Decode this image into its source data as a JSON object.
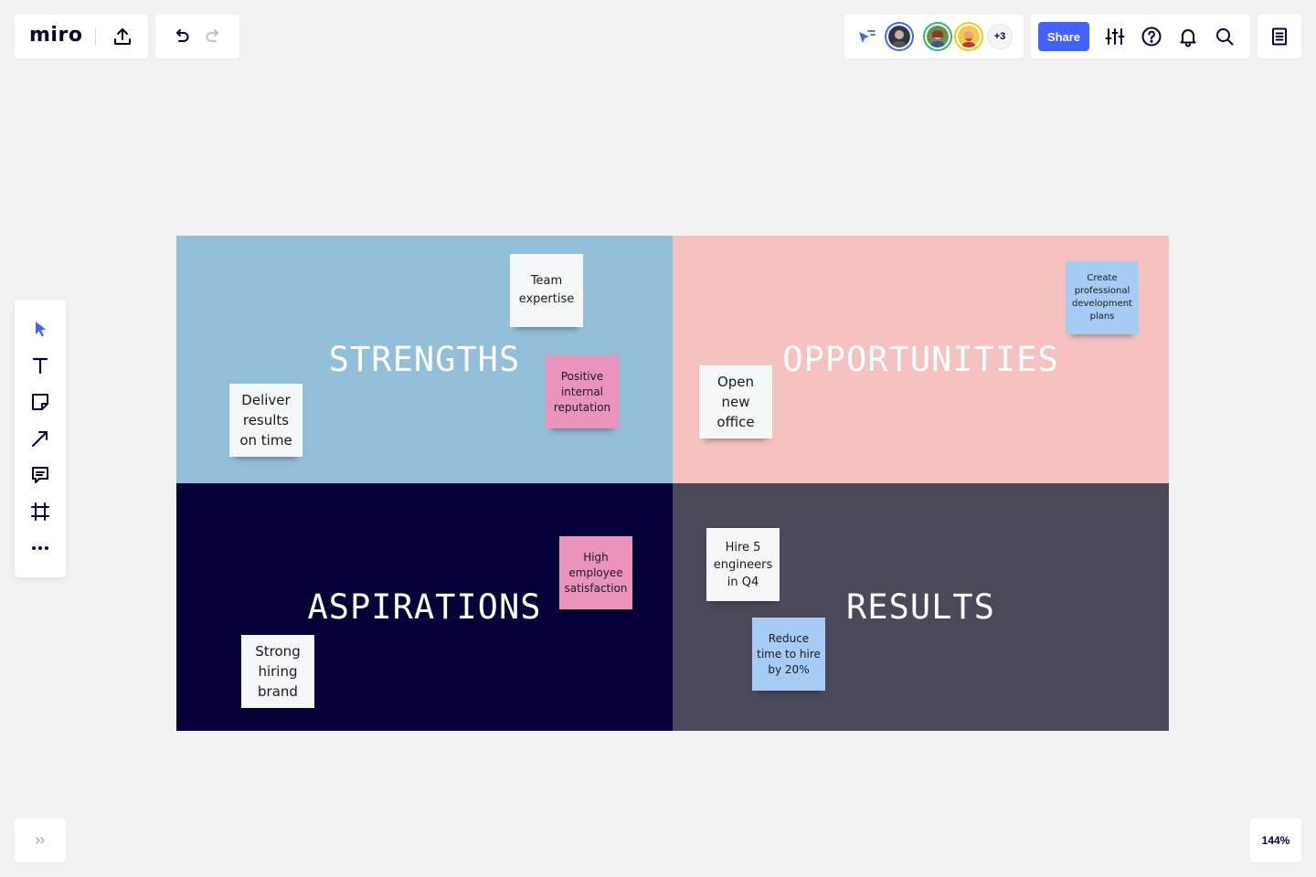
{
  "app": {
    "logo": "miro",
    "zoom_level": "144%"
  },
  "header": {
    "upload_icon": "upload-icon",
    "undo_icon": "undo-icon",
    "redo_icon": "redo-icon",
    "collaborators": {
      "attention_icon": "cursor-follow-icon",
      "more_count": "+3",
      "avatar_ring_colors": [
        "#4262ff",
        "#2fb85e",
        "#fac710"
      ]
    },
    "share_label": "Share",
    "tools": [
      "settings-sliders-icon",
      "help-icon",
      "bell-icon",
      "search-icon"
    ],
    "notes_icon": "notes-icon"
  },
  "toolbar": {
    "items": [
      {
        "name": "select-tool",
        "icon": "cursor-icon"
      },
      {
        "name": "text-tool",
        "icon": "text-icon"
      },
      {
        "name": "sticky-note-tool",
        "icon": "sticky-note-icon"
      },
      {
        "name": "connection-line-tool",
        "icon": "arrow-icon"
      },
      {
        "name": "comment-tool",
        "icon": "comment-icon"
      },
      {
        "name": "frame-tool",
        "icon": "frame-icon"
      },
      {
        "name": "more-tools",
        "icon": "more-icon"
      }
    ],
    "accent_color": "#4262ff"
  },
  "board": {
    "quadrants": [
      {
        "title": "STRENGTHS",
        "color": "#93bed8"
      },
      {
        "title": "OPPORTUNITIES",
        "color": "#f5c2c1"
      },
      {
        "title": "ASPIRATIONS",
        "color": "#050038"
      },
      {
        "title": "RESULTS",
        "color": "#4a4859"
      }
    ],
    "stickies": {
      "team_expertise": {
        "text": "Team expertise",
        "color": "#f5f6f8"
      },
      "positive_reputation": {
        "text": "Positive internal reputation",
        "color": "#ea94bb"
      },
      "deliver_results": {
        "text": "Deliver results on time",
        "color": "#f5f6f8"
      },
      "open_office": {
        "text": "Open new office",
        "color": "#f5f6f8"
      },
      "development_plans": {
        "text": "Create professional development plans",
        "color": "#a6ccf5"
      },
      "employee_satisfaction": {
        "text": "High employee satisfaction",
        "color": "#ea94bb"
      },
      "hiring_brand": {
        "text": "Strong hiring brand",
        "color": "#f5f6f8"
      },
      "hire_engineers": {
        "text": "Hire 5 engineers in Q4",
        "color": "#f5f6f8"
      },
      "reduce_hire_time": {
        "text": "Reduce time to hire by 20%",
        "color": "#a6ccf5"
      }
    }
  }
}
